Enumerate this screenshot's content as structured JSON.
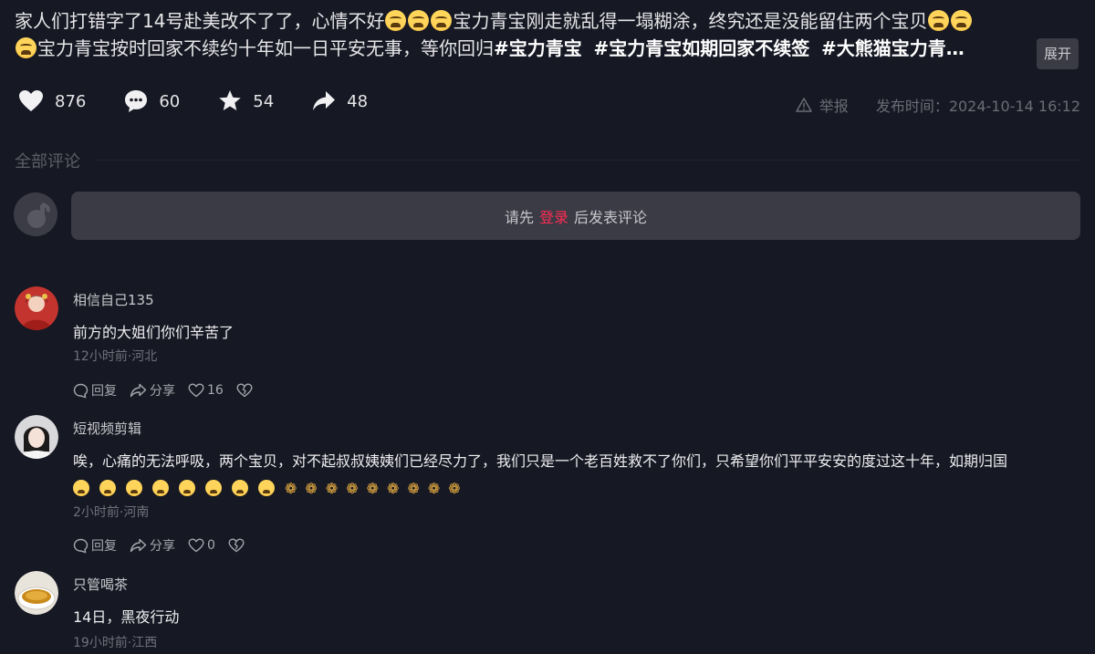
{
  "post": {
    "desc_parts": {
      "l1_a": "家人们打错字了14号赴美改不了了，心情不好",
      "l1_b": "宝力青宝刚走就乱得一塌糊涂，终究还是没能留住两个宝贝",
      "l2_a": "宝力青宝按时回家不续约十年如一日平安无事，等你回归",
      "tag1": "#宝力青宝",
      "tag2": "#宝力青宝如期回家不续签",
      "tag3": "#大熊猫宝力青…"
    },
    "emoji": "crying-face-emoji",
    "expand_label": "展开",
    "stats": {
      "likes": "876",
      "comments": "60",
      "favorites": "54",
      "shares": "48"
    },
    "report_label": "举报",
    "publish_time": "发布时间：2024-10-14 16:12"
  },
  "comments_section": {
    "title": "全部评论",
    "login_prompt_before": "请先",
    "login_link": "登录",
    "login_prompt_after": "后发表评论"
  },
  "actions": {
    "reply": "回复",
    "share": "分享"
  },
  "comments": [
    {
      "user": "相信自己135",
      "text": "前方的大姐们你们辛苦了",
      "time": "12小时前·河北",
      "likes": "16"
    },
    {
      "user": "短视频剪辑",
      "text": "唉，心痛的无法呼吸，两个宝贝，对不起叔叔姨姨们已经尽力了，我们只是一个老百姓救不了你们，只希望你们平平安安的度过这十年，如期归国",
      "emoji_row": "8 crying-face-emoji, 9 folded-hands-emoji",
      "time": "2小时前·河南",
      "likes": "0"
    },
    {
      "user": "只管喝茶",
      "text": "14日，黑夜行动",
      "time": "19小时前·江西"
    }
  ],
  "colors": {
    "background": "#161823",
    "accent": "#fe2c55",
    "input_bg": "#3a3b44"
  }
}
